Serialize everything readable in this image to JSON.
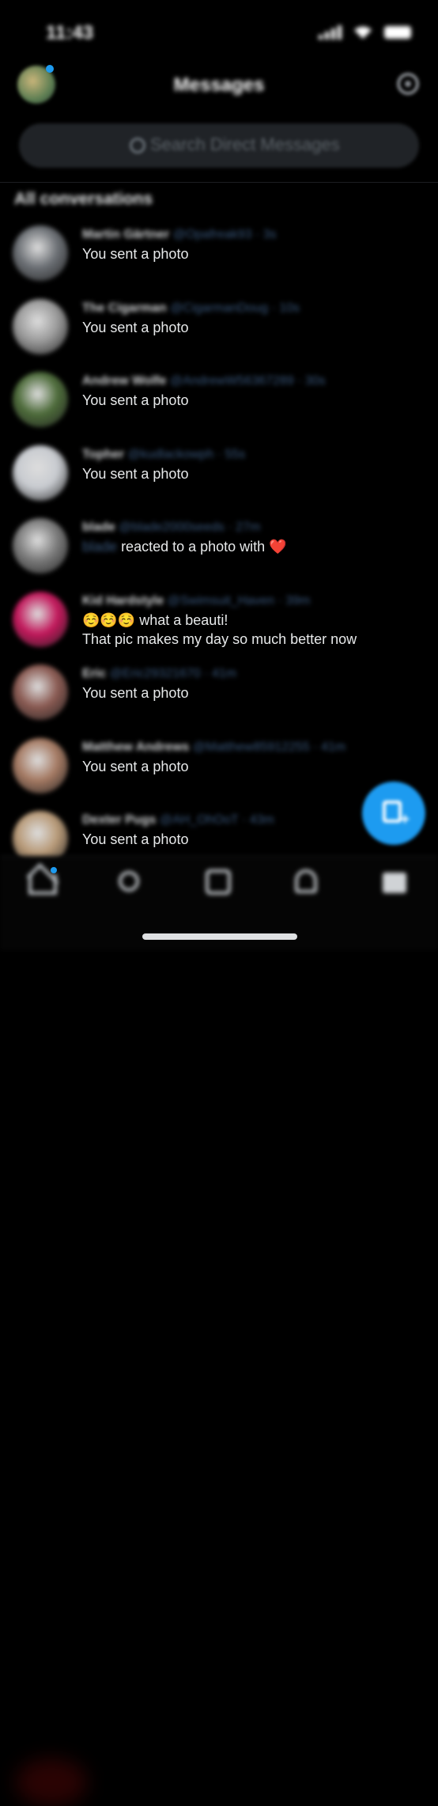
{
  "status_bar": {
    "time": "11:43"
  },
  "header": {
    "title": "Messages"
  },
  "search": {
    "placeholder": "Search Direct Messages"
  },
  "section_title": "All conversations",
  "conversations": [
    {
      "name": "Martin Gärtner",
      "handle": "@Opafreak93",
      "time": "3s",
      "preview": "You sent a photo",
      "avatar_color": "#6b6f74"
    },
    {
      "name": "The Cigarman",
      "handle": "@CigarmanDoug",
      "time": "10s",
      "preview": "You sent a photo",
      "avatar_color": "#9a9a9a"
    },
    {
      "name": "Andrew Wolfe",
      "handle": "@AndrewW56367289",
      "time": "30s",
      "preview": "You sent a photo",
      "avatar_color": "#4d6b3a"
    },
    {
      "name": "Topher",
      "handle": "@kudlackowph",
      "time": "55s",
      "preview": "You sent a photo",
      "avatar_color": "#c8cbd0"
    },
    {
      "name": "blade",
      "handle": "@blade2000seeds",
      "time": "27m",
      "preview_blurred": "blade",
      "preview": "reacted to a photo with",
      "reaction": "❤️",
      "avatar_color": "#7a7a7a"
    },
    {
      "name": "Kid Hardstyle",
      "handle": "@Swimsuit_Haven",
      "time": "39m",
      "preview": "☺️☺️☺️ what a beauti!",
      "preview2": "That pic makes my day so much better now",
      "avatar_color": "#c2185b"
    },
    {
      "name": "Eric",
      "handle": "@Eric29321670",
      "time": "41m",
      "preview": "You sent a photo",
      "avatar_color": "#8a5a52"
    },
    {
      "name": "Matthew Andrews",
      "handle": "@Matthew85912255",
      "time": "41m",
      "preview": "You sent a photo",
      "avatar_color": "#a57a63"
    },
    {
      "name": "Dexter Pugs",
      "handle": "@AH_OhOoT",
      "time": "43m",
      "preview": "You sent a photo",
      "avatar_color": "#b89a78"
    }
  ],
  "colors": {
    "accent": "#1d9bf0",
    "background": "#000000"
  }
}
